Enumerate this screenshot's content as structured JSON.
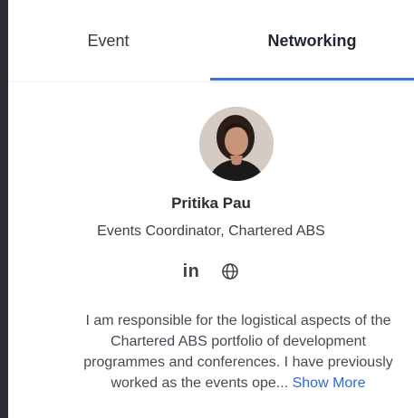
{
  "tabs": {
    "event": "Event",
    "networking": "Networking",
    "active": "Networking"
  },
  "profile": {
    "name": "Pritika Pau",
    "title": "Events Coordinator, Chartered ABS",
    "socials": {
      "linkedin_label": "in",
      "linkedin_icon": "linkedin-icon",
      "website_icon": "globe-icon"
    },
    "bio_lines": [
      "I am responsible for the logistical aspects of the",
      "Chartered ABS portfolio of development",
      "programmes and conferences. I have previously",
      "worked as the events ope..."
    ],
    "show_more": "Show More"
  },
  "colors": {
    "accent": "#3b74e5",
    "link": "#2c6ad8",
    "sidebar_edge": "#2b2d33"
  }
}
